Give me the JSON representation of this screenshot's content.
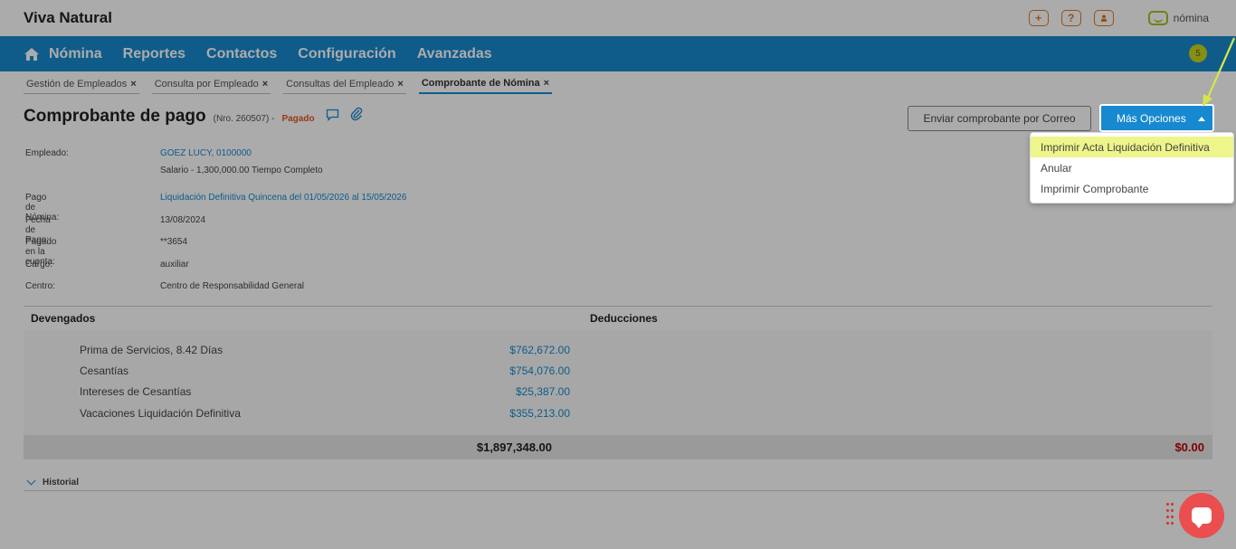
{
  "app": {
    "brand": "Viva Natural",
    "logo_text": "nómina"
  },
  "top_icons": [
    {
      "name": "plus-icon",
      "glyph": "+"
    },
    {
      "name": "help-icon",
      "glyph": "?"
    },
    {
      "name": "user-icon",
      "glyph": "●"
    }
  ],
  "nav": {
    "items": [
      "Nómina",
      "Reportes",
      "Contactos",
      "Configuración",
      "Avanzadas"
    ],
    "badge": "5"
  },
  "tabs": [
    {
      "label": "Gestión de Empleados",
      "active": false
    },
    {
      "label": "Consulta por Empleado",
      "active": false
    },
    {
      "label": "Consultas del Empleado",
      "active": false
    },
    {
      "label": "Comprobante de Nómina",
      "active": true
    }
  ],
  "tab_close": "×",
  "header": {
    "title": "Comprobante de pago",
    "nro": "(Nro. 260507) -",
    "status": "Pagado",
    "email_button": "Enviar comprobante por Correo",
    "more_button": "Más Opciones"
  },
  "dropdown": {
    "items": [
      "Imprimir Acta Liquidación Definitiva",
      "Anular",
      "Imprimir Comprobante"
    ],
    "highlighted_index": 0
  },
  "info": {
    "empleado_label": "Empleado:",
    "empleado_value": "GOEZ LUCY, 0100000",
    "salario": "Salario - 1,300,000.00 Tiempo Completo",
    "pago_label": "Pago de Nómina:",
    "pago_value": "Liquidación Definitiva Quincena del 01/05/2026 al 15/05/2026",
    "fecha_label": "Fecha de Pago:",
    "fecha_value": "13/08/2024",
    "cuenta_label": "Pagado en la cuenta:",
    "cuenta_value": "**3654",
    "cargo_label": "Cargo:",
    "cargo_value": "auxiliar",
    "centro_label": "Centro:",
    "centro_value": "Centro de Responsabilidad General"
  },
  "table": {
    "devengados_header": "Devengados",
    "deducciones_header": "Deducciones",
    "devengados": [
      {
        "concept": "Prima de Servicios, 8.42 Días",
        "amount": "$762,672.00"
      },
      {
        "concept": "Cesantías",
        "amount": "$754,076.00"
      },
      {
        "concept": "Intereses de Cesantías",
        "amount": "$25,387.00"
      },
      {
        "concept": "Vacaciones Liquidación Definitiva",
        "amount": "$355,213.00"
      }
    ],
    "total_devengados": "$1,897,348.00",
    "total_deducciones": "$0.00"
  },
  "historial": "Historial",
  "colors": {
    "brand_blue": "#1789d0",
    "accent_orange": "#e07a1f",
    "status_orange": "#e05a1a",
    "total_red": "#c00000",
    "highlight_yellow": "#eef58a",
    "chat_red": "#ea4e4e"
  }
}
